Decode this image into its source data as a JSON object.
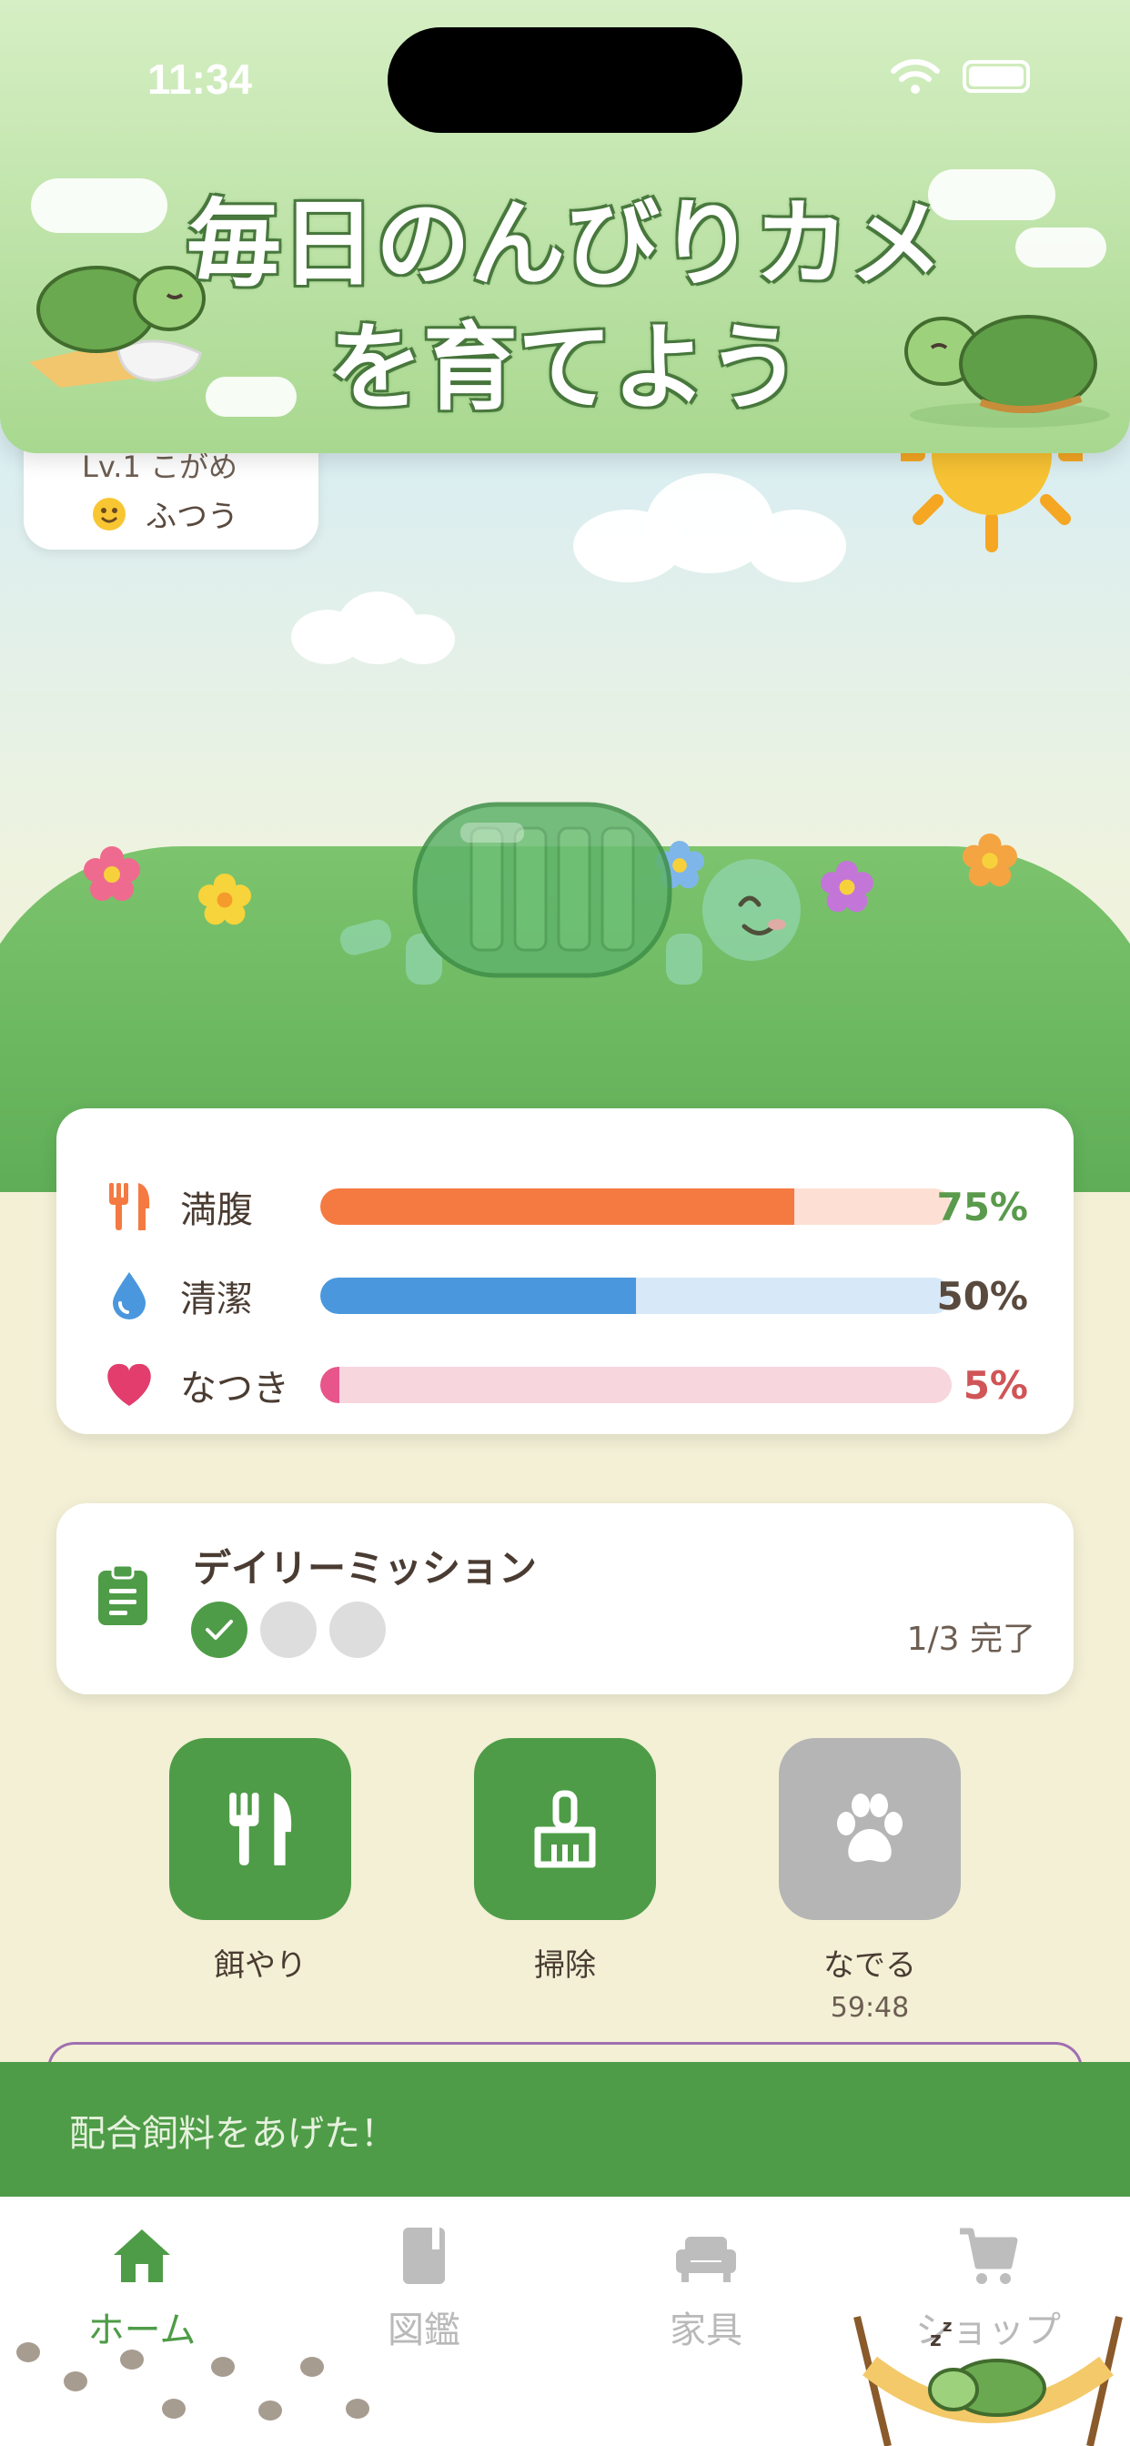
{
  "status_bar": {
    "time": "11:34"
  },
  "banner": {
    "title_line1": "毎日のんびりカメ",
    "title_line2": "を育てよう"
  },
  "pet": {
    "level_text": "Lv.1 こがめ",
    "mood_text": "ふつう"
  },
  "stats": [
    {
      "icon": "fork-knife-icon",
      "label": "満腹",
      "value_text": "75%",
      "value": 75,
      "fill_color": "#f47a42",
      "track_color": "#fde0d3",
      "value_color": "#5a9a4c"
    },
    {
      "icon": "water-drop-icon",
      "label": "清潔",
      "value_text": "50%",
      "value": 50,
      "fill_color": "#4a97dd",
      "track_color": "#d7e9f8",
      "value_color": "#5a4a3e"
    },
    {
      "icon": "heart-icon",
      "label": "なつき",
      "value_text": "5%",
      "value": 3,
      "fill_color": "#e8558a",
      "track_color": "#f7d6de",
      "value_color": "#d05557"
    }
  ],
  "mission": {
    "title": "デイリーミッション",
    "progress_text": "1/3 完了",
    "completed": 1,
    "total": 3
  },
  "actions": [
    {
      "icon": "fork-knife-icon",
      "label": "餌やり",
      "sub": "",
      "enabled": true
    },
    {
      "icon": "broom-icon",
      "label": "掃除",
      "sub": "",
      "enabled": true
    },
    {
      "icon": "paw-icon",
      "label": "なでる",
      "sub": "59:48",
      "enabled": false
    }
  ],
  "toast": {
    "message": "配合飼料をあげた！"
  },
  "tabs": [
    {
      "icon": "home-icon",
      "label": "ホーム",
      "active": true
    },
    {
      "icon": "book-icon",
      "label": "図鑑",
      "active": false
    },
    {
      "icon": "sofa-icon",
      "label": "家具",
      "active": false
    },
    {
      "icon": "cart-icon",
      "label": "ショップ",
      "active": false
    }
  ],
  "colors": {
    "accent_green": "#4e9c47",
    "disabled_gray": "#b5b5b5",
    "background": "#f3f0d6"
  }
}
